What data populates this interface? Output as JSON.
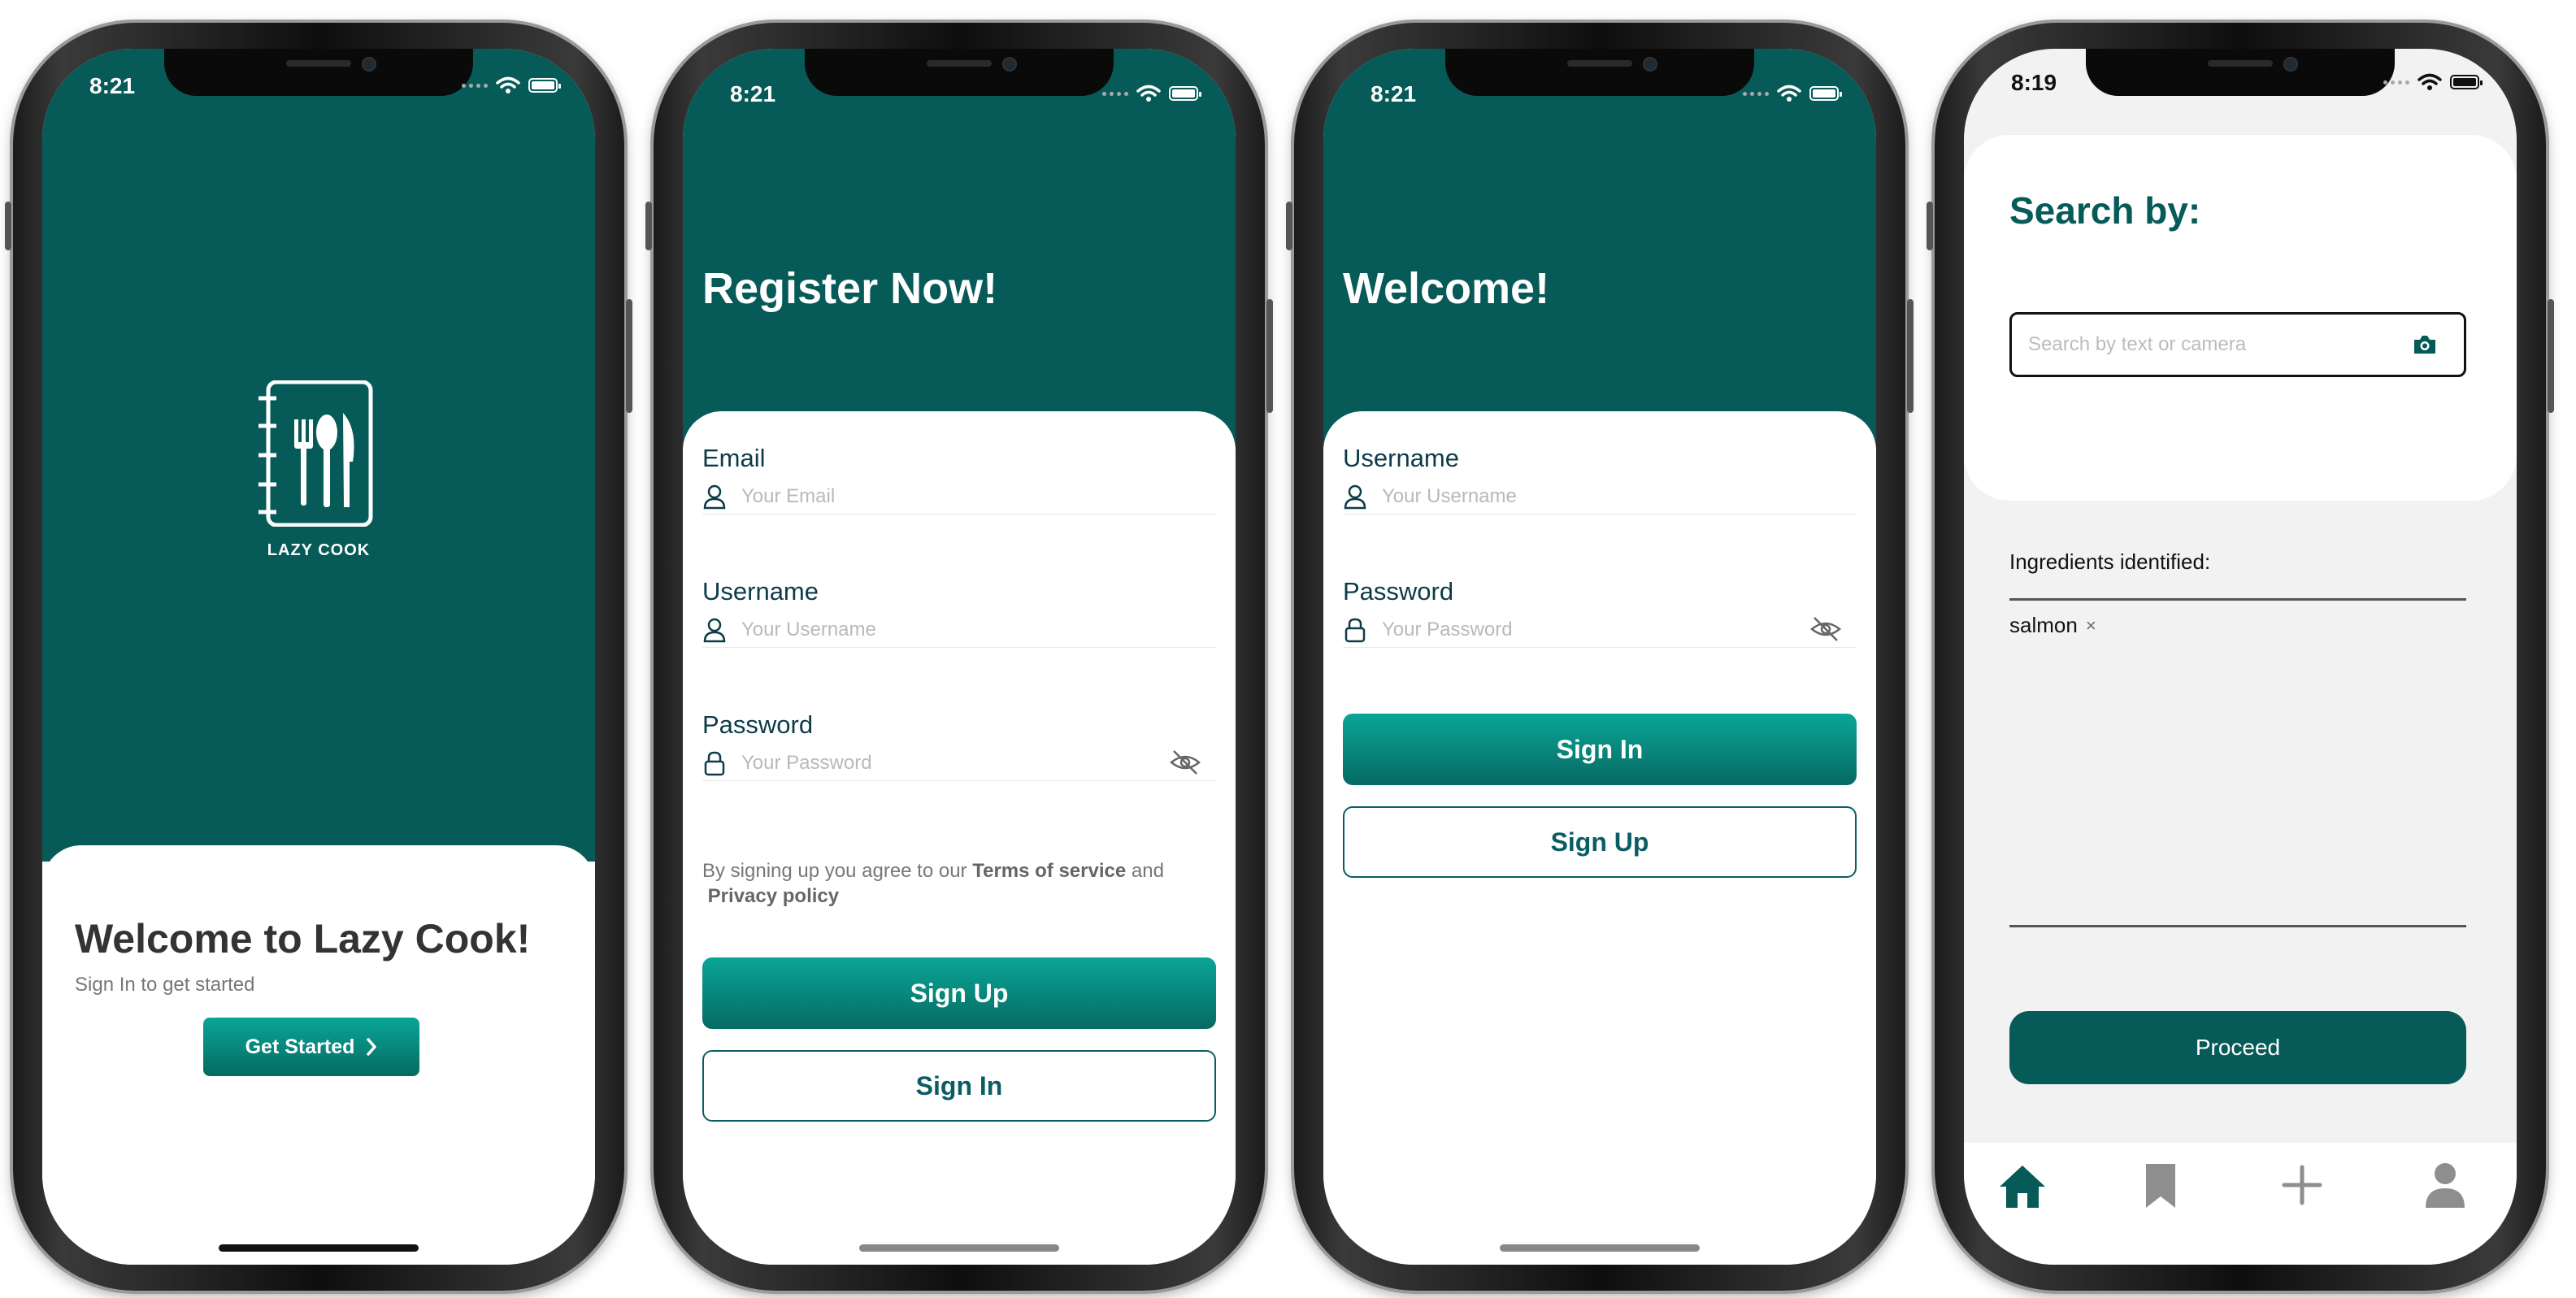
{
  "status": {
    "time_1": "8:21",
    "time_2": "8:21",
    "time_3": "8:21",
    "time_4": "8:19"
  },
  "colors": {
    "brand_teal": "#065a58",
    "button_gradient_top": "#0aa597",
    "button_gradient_bottom": "#066a62"
  },
  "splash": {
    "logo_text": "LAZY COOK",
    "heading": "Welcome to Lazy Cook!",
    "subtitle": "Sign In to get started",
    "cta_label": "Get Started"
  },
  "register": {
    "title": "Register Now!",
    "email_label": "Email",
    "email_placeholder": "Your Email",
    "username_label": "Username",
    "username_placeholder": "Your Username",
    "password_label": "Password",
    "password_placeholder": "Your Password",
    "terms_prefix": "By signing up you agree to our",
    "terms_link": "Terms of service",
    "terms_and": "and",
    "privacy_link": "Privacy policy",
    "primary_button": "Sign Up",
    "secondary_button": "Sign In"
  },
  "login": {
    "title": "Welcome!",
    "username_label": "Username",
    "username_placeholder": "Your Username",
    "password_label": "Password",
    "password_placeholder": "Your Password",
    "primary_button": "Sign In",
    "secondary_button": "Sign Up"
  },
  "search": {
    "title": "Search by:",
    "input_placeholder": "Search by text or camera",
    "ingredients_label": "Ingredients identified:",
    "tags": [
      {
        "label": "salmon",
        "remove": "×"
      }
    ],
    "proceed_button": "Proceed",
    "tabbar": [
      {
        "icon": "home-icon",
        "active": true
      },
      {
        "icon": "bookmark-icon",
        "active": false
      },
      {
        "icon": "plus-icon",
        "active": false
      },
      {
        "icon": "user-icon",
        "active": false
      }
    ]
  }
}
